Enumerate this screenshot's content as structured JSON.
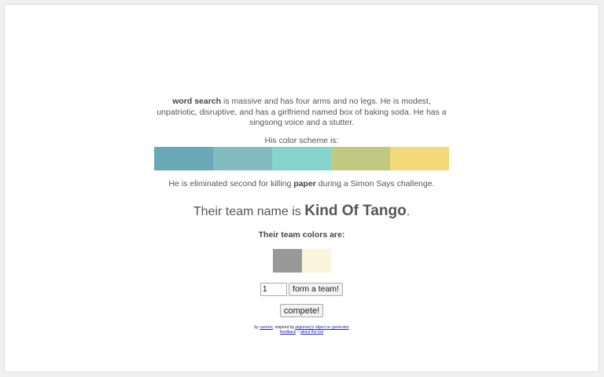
{
  "description": {
    "subject": "word search",
    "text_part1": " is massive and has four arms and no legs. He is modest, unpatriotic, disruptive, and has a girlfriend named box of baking soda. He has a singsong voice and a stutter."
  },
  "scheme": {
    "label": "His color scheme is:",
    "colors": [
      "#6aa8b8",
      "#82bcbe",
      "#86d5cd",
      "#c0c981",
      "#f3d977"
    ]
  },
  "elimination": {
    "prefix": "He is eliminated second for killing ",
    "victim": "paper",
    "suffix": " during a Simon Says challenge."
  },
  "team": {
    "prefix": "Their team name is ",
    "name": "Kind Of Tango",
    "suffix": ".",
    "colors_label": "Their team colors are:",
    "colors": [
      "#999999",
      "#faf5dc"
    ]
  },
  "controls": {
    "count_value": "1",
    "form_button": "form a team!",
    "compete_button": "compete!"
  },
  "footer": {
    "by": "by ",
    "author": "cazenic",
    "inspired": ", inspired by ",
    "inspiration": "pigtonary's object oc generator",
    "feedback": "feedback",
    "sep": " ~ ",
    "about": "about the bot"
  }
}
